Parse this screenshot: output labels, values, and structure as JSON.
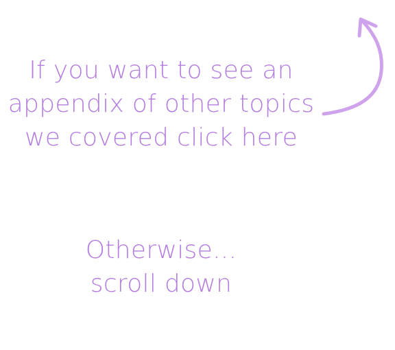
{
  "appendix_prompt": {
    "lines": [
      "If you want to see an",
      "appendix of other topics",
      "we covered click here"
    ]
  },
  "scroll_prompt": {
    "lines": [
      "Otherwise...",
      "scroll down"
    ]
  },
  "colors": {
    "text": "#b57de0",
    "arrow": "#cfa3ec",
    "background": "#ffffff"
  },
  "icons": {
    "arrow": "curved-up-arrow-icon"
  }
}
